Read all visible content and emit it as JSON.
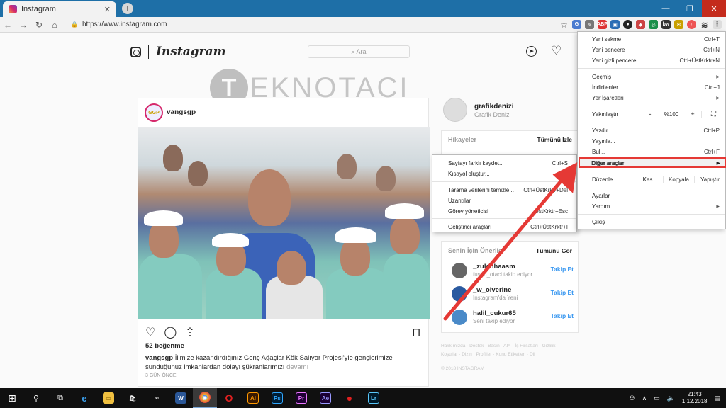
{
  "browser": {
    "tab_title": "Instagram",
    "new_tab": "+",
    "tab_close": "✕",
    "url": "https://www.instagram.com",
    "window_controls": {
      "minimize": "—",
      "maximize": "❐",
      "close": "✕"
    }
  },
  "instagram": {
    "logo_text": "Instagram",
    "search_placeholder": "⌕ Ara",
    "watermark": "EKNOTACI",
    "watermark_mark": "T",
    "post": {
      "avatar_text": "GGP",
      "username": "vangsgp",
      "likes": "52 beğenme",
      "caption_user": "vangsgp",
      "caption_text": " İlimize kazandırdığınız Genç Ağaçlar Kök Salıyor Projesi'yle gençlerimize sunduğunuz imkanlardan dolayı şükranlarımızı ",
      "caption_more": "devamı",
      "time": "3 GÜN ÖNCE"
    },
    "me": {
      "username": "grafikdenizi",
      "name": "Grafik Denizi"
    },
    "stories": {
      "title": "Hikayeler",
      "see_all": "Tümünü İzle"
    },
    "suggestions": {
      "title": "Senin İçin Öneriler",
      "see_all": "Tümünü Gör",
      "items": [
        {
          "user": "_zulcnhaasm",
          "desc": "fusun_otaci takip ediyor",
          "action": "Takip Et"
        },
        {
          "user": "_w_olverine",
          "desc": "Instagram'da Yeni",
          "action": "Takip Et"
        },
        {
          "user": "halil_cukur65",
          "desc": "Seni takip ediyor",
          "action": "Takip Et"
        }
      ]
    },
    "footer_links": "Hakkımızda · Destek · Basın · API · İş Fırsatları · Gizlilik · Koşullar · Dizin · Profiller · Konu Etiketleri · Dil",
    "copyright": "© 2018 INSTAGRAM"
  },
  "submenu": [
    {
      "label": "Sayfayı farklı kaydet...",
      "shortcut": "Ctrl+S"
    },
    {
      "label": "Kısayol oluştur...",
      "shortcut": ""
    },
    {
      "label": "Tarama verilerini temizle...",
      "shortcut": "Ctrl+ÜstKrktr+Del"
    },
    {
      "label": "Uzantılar",
      "shortcut": ""
    },
    {
      "label": "Görev yöneticisi",
      "shortcut": "ÜstKrktr+Esc"
    },
    {
      "label": "Geliştirici araçları",
      "shortcut": "Ctrl+ÜstKrktr+I"
    }
  ],
  "mainmenu": {
    "new_tab": {
      "label": "Yeni sekme",
      "shortcut": "Ctrl+T"
    },
    "new_window": {
      "label": "Yeni pencere",
      "shortcut": "Ctrl+N"
    },
    "incognito": {
      "label": "Yeni gizli pencere",
      "shortcut": "Ctrl+ÜstKrktr+N"
    },
    "history": {
      "label": "Geçmiş"
    },
    "downloads": {
      "label": "İndirilenler",
      "shortcut": "Ctrl+J"
    },
    "bookmarks": {
      "label": "Yer İşaretleri"
    },
    "zoom": {
      "label": "Yakınlaştır",
      "minus": "-",
      "value": "%100",
      "plus": "+",
      "fullscreen": "⛶"
    },
    "print": {
      "label": "Yazdır...",
      "shortcut": "Ctrl+P"
    },
    "cast": {
      "label": "Yayınla..."
    },
    "find": {
      "label": "Bul...",
      "shortcut": "Ctrl+F"
    },
    "more_tools": {
      "label": "Diğer araçlar"
    },
    "edit": {
      "label": "Düzenle",
      "cut": "Kes",
      "copy": "Kopyala",
      "paste": "Yapıştır"
    },
    "settings": {
      "label": "Ayarlar"
    },
    "help": {
      "label": "Yardım"
    },
    "exit": {
      "label": "Çıkış"
    }
  },
  "taskbar": {
    "start_icon": "⊞",
    "search_icon": "⚲",
    "clock_time": "21:43",
    "clock_date": "1.12.2018",
    "apps": [
      "e",
      "▭",
      "🛍",
      "✉",
      "W",
      "◉",
      "O",
      "Ai",
      "Ps",
      "Pr",
      "Ae",
      "●",
      "Lr"
    ]
  },
  "colors": {
    "accent_red": "#e53935",
    "link_blue": "#3897f0",
    "taskbar": "#101010"
  }
}
